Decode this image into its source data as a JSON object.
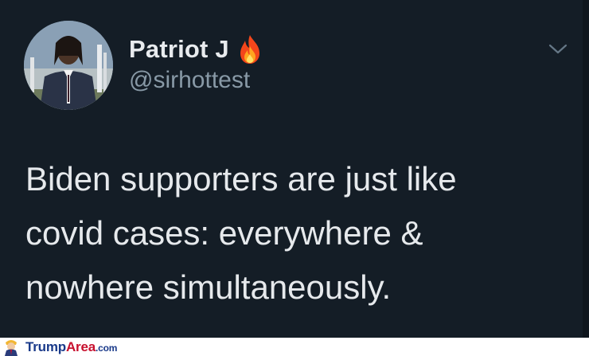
{
  "tweet": {
    "display_name": "Patriot J",
    "handle": "@sirhottest",
    "text_lines": [
      "Biden supporters are just like",
      "covid cases: everywhere &",
      "nowhere simultaneously."
    ],
    "icons": {
      "name_emoji": "fire-icon",
      "menu": "chevron-down-icon"
    }
  },
  "watermark": {
    "part1": "Trump",
    "part2": "Area",
    "part3": ".com",
    "icon": "mascot-icon"
  },
  "colors": {
    "background": "#141d26",
    "name": "#e8ebee",
    "handle": "#8899a6",
    "brand_blue": "#1a3a8a",
    "brand_red": "#c8102e"
  }
}
